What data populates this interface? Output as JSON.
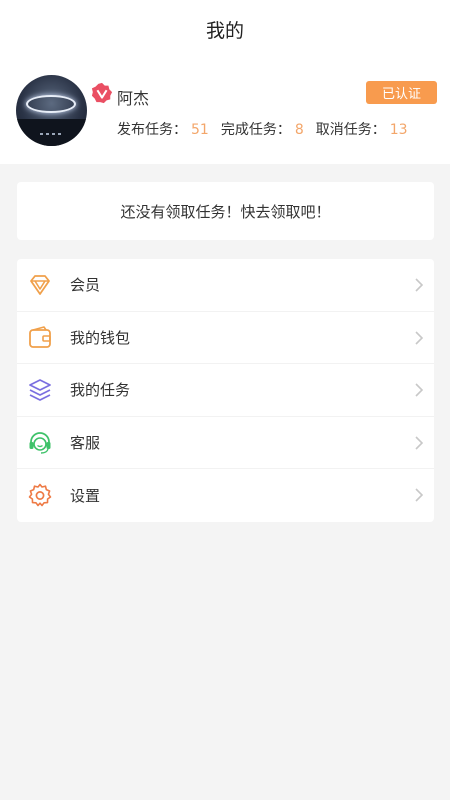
{
  "header": {
    "title": "我的"
  },
  "profile": {
    "username": "阿杰",
    "verified_label": "已认证",
    "stats": [
      {
        "label": "发布任务：",
        "value": "51"
      },
      {
        "label": "完成任务：",
        "value": "8"
      },
      {
        "label": "取消任务：",
        "value": "13"
      }
    ]
  },
  "notice": {
    "text": "还没有领取任务！快去领取吧！"
  },
  "menu": {
    "items": [
      {
        "label": "会员",
        "icon": "diamond-icon",
        "color": "#f0a04b"
      },
      {
        "label": "我的钱包",
        "icon": "wallet-icon",
        "color": "#f0a04b"
      },
      {
        "label": "我的任务",
        "icon": "layers-icon",
        "color": "#7b6fe0"
      },
      {
        "label": "客服",
        "icon": "headset-icon",
        "color": "#3fc26a"
      },
      {
        "label": "设置",
        "icon": "gear-icon",
        "color": "#ee7a45"
      }
    ]
  },
  "colors": {
    "accent": "#f89b4e",
    "stat_number": "#f3a66a",
    "background": "#f4f4f4"
  }
}
